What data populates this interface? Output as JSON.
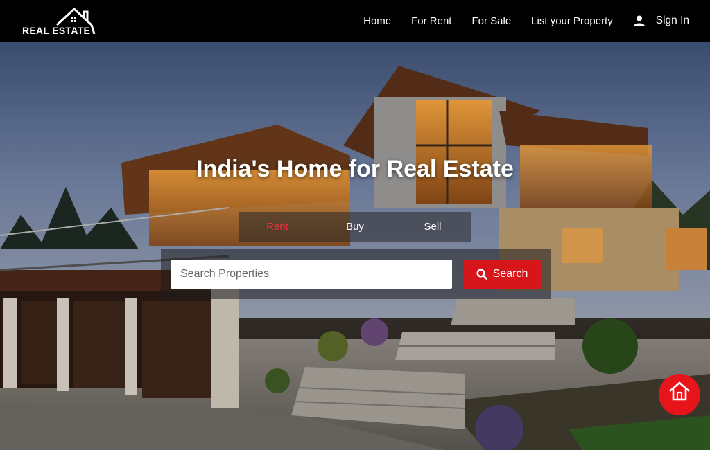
{
  "brand": {
    "logo_text": "REAL ESTATE"
  },
  "nav": {
    "items": [
      {
        "label": "Home"
      },
      {
        "label": "For Rent"
      },
      {
        "label": "For Sale"
      },
      {
        "label": "List your Property"
      }
    ],
    "signin_label": "Sign In",
    "signin_icon": "user-icon"
  },
  "hero": {
    "title": "India's Home for Real Estate",
    "tabs": [
      {
        "label": "Rent",
        "active": true
      },
      {
        "label": "Buy",
        "active": false
      },
      {
        "label": "Sell",
        "active": false
      }
    ],
    "search": {
      "placeholder": "Search Properties",
      "value": "",
      "button_label": "Search",
      "button_icon": "search-icon"
    }
  },
  "fab": {
    "icon": "home-icon"
  },
  "colors": {
    "accent": "#d7161b",
    "active_tab": "#e8333f",
    "navbar_bg": "#000000"
  }
}
